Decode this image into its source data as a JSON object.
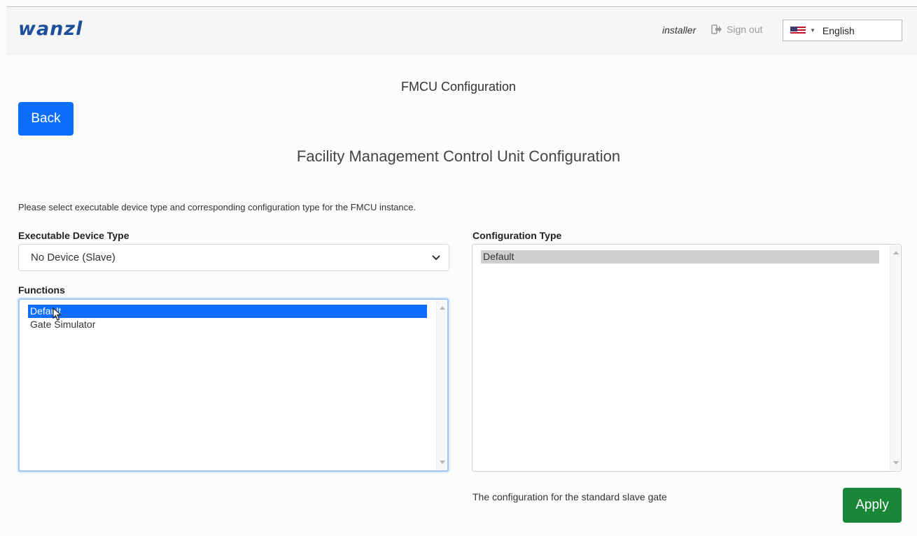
{
  "header": {
    "logo_text": "wanzl",
    "user_name": "installer",
    "sign_out_label": "Sign out",
    "language": "English",
    "language_flag": "us-flag-icon"
  },
  "page": {
    "title": "FMCU Configuration",
    "back_label": "Back",
    "subtitle": "Facility Management Control Unit Configuration",
    "instruction": "Please select executable device type and corresponding configuration type for the FMCU instance."
  },
  "device_type": {
    "label": "Executable Device Type",
    "selected_value": "No Device (Slave)"
  },
  "functions": {
    "label": "Functions",
    "options": [
      "Default",
      "Gate Simulator"
    ],
    "selected_index": 0
  },
  "configuration": {
    "label": "Configuration Type",
    "options": [
      "Default"
    ],
    "selected_index": 0,
    "description": "The configuration for the standard slave gate"
  },
  "apply_label": "Apply",
  "colors": {
    "logo": "#1d4f9c",
    "primary": "#0d6efd",
    "success": "#198737",
    "selection_inactive": "#cfcfcf"
  }
}
